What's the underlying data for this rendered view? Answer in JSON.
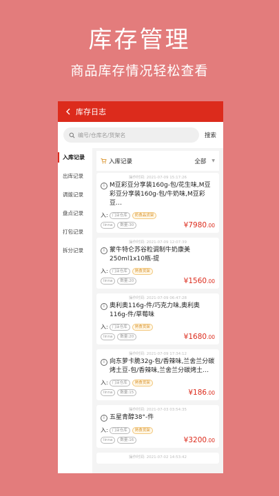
{
  "promo": {
    "title": "库存管理",
    "subtitle": "商品库存情况轻松查看"
  },
  "topbar": {
    "title": "库存日志"
  },
  "search": {
    "placeholder": "编号/仓库名/货架名",
    "button": "搜索"
  },
  "sidebar": {
    "items": [
      "入库记录",
      "出库记录",
      "调拨记录",
      "盘点记录",
      "打包记录",
      "拆分记录"
    ],
    "active": 0
  },
  "list_header": {
    "title": "入库记录",
    "filter": "全部"
  },
  "records": [
    {
      "time": "操作时间: 2021-07-09 15:17:26",
      "name": "M豆彩豆分享装160g-包/花生味,M豆彩豆分享装160g-包/牛奶味,M豆彩豆…",
      "direction": "入:",
      "warehouse": "门店仓库",
      "category": "奶食品货架",
      "user": "linna",
      "qty": "数量:30",
      "price": "¥7980",
      "cents": ".00"
    },
    {
      "time": "操作时间: 2021-07-09 12:07:39",
      "name": "蒙牛特仑苏谷粒调制牛奶康美250ml1x10瓶-提",
      "direction": "入:",
      "warehouse": "门店仓库",
      "category": "熟食货架",
      "user": "linna",
      "qty": "数量:20",
      "price": "¥1560",
      "cents": ".00"
    },
    {
      "time": "操作时间: 2021-07-09 06:47:28",
      "name": "奥利奥116g-件/巧克力味,奥利奥116g-件/草莓味",
      "direction": "入:",
      "warehouse": "门店仓库",
      "category": "熟食货架",
      "user": "linna",
      "qty": "数量:20",
      "price": "¥1680",
      "cents": ".00"
    },
    {
      "time": "操作时间: 2021-07-09 17:34:12",
      "name": "向东萝卡脆32g-包/香辣味,兰舍兰分碳烤土豆-包/香辣味,兰舍兰分碳烤土…",
      "direction": "入:",
      "warehouse": "门店仓库",
      "category": "熟食货架",
      "user": "linna",
      "qty": "数量:15",
      "price": "¥186",
      "cents": ".00"
    },
    {
      "time": "操作时间: 2021-07-03 03:54:35",
      "name": "五星青醇38°-件",
      "direction": "入:",
      "warehouse": "门店仓库",
      "category": "熟食货架",
      "user": "linna",
      "qty": "数量:16",
      "price": "¥3200",
      "cents": ".00"
    },
    {
      "time": "操作时间: 2021-07-02 14:53:42",
      "name": "",
      "direction": "",
      "warehouse": "",
      "category": "",
      "user": "",
      "qty": "",
      "price": "",
      "cents": ""
    }
  ]
}
